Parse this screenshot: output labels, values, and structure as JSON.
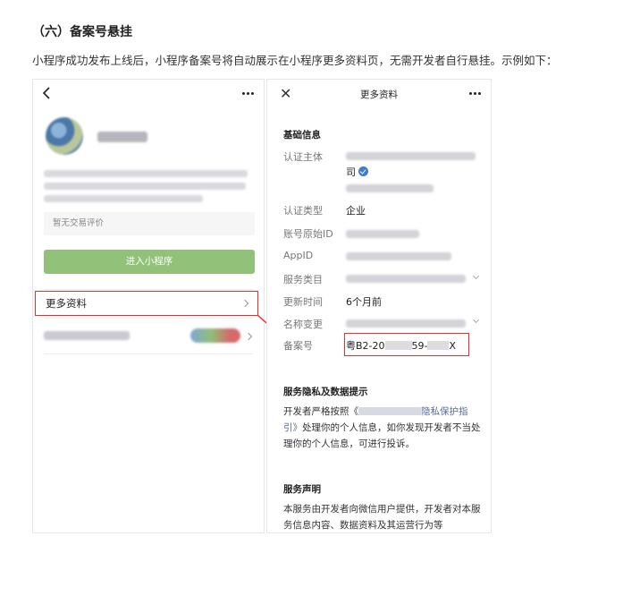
{
  "section": {
    "heading": "（六）备案号悬挂",
    "intro": "小程序成功发布上线后，小程序备案号将自动展示在小程序更多资料页，无需开发者自行悬挂。示例如下："
  },
  "left_screen": {
    "review_placeholder": "暂无交易评价",
    "enter_button": "进入小程序",
    "more_info_label": "更多资料"
  },
  "right_screen": {
    "title": "更多资料",
    "basic_section": "基础信息",
    "labels": {
      "cert_subject": "认证主体",
      "cert_type": "认证类型",
      "account_id": "账号原始ID",
      "appid": "AppID",
      "service_category": "服务类目",
      "update_time": "更新时间",
      "name_change": "名称变更",
      "filing_no": "备案号"
    },
    "values": {
      "cert_subject_tail": "司",
      "cert_type": "企业",
      "update_time": "6个月前"
    },
    "filing": {
      "part1": "粤B2-20",
      "part2": "59-",
      "part3": "X"
    },
    "privacy": {
      "heading": "服务隐私及数据提示",
      "text_start": "开发者严格按照《",
      "link_text": "隐私保护指引》",
      "text_end": "处理你的个人信息，如你发现开发者不当处理你的个人信息，可进行投诉。"
    },
    "statement": {
      "heading": "服务声明",
      "text": "本服务由开发者向微信用户提供，开发者对本服务信息内容、数据资料及其运营行为等"
    }
  },
  "colors": {
    "enter_button": "#92c27a",
    "highlight_red": "#e03232",
    "link": "#576b95",
    "verify_badge": "#3d7bd6"
  }
}
